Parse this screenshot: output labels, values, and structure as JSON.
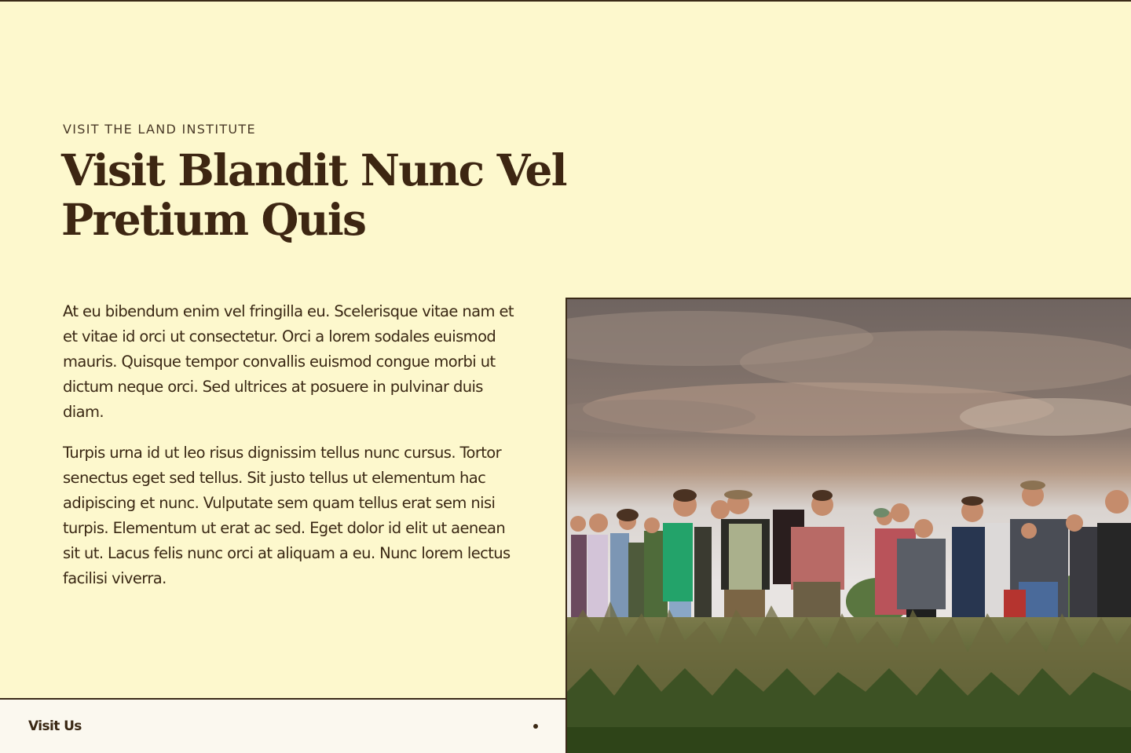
{
  "hero": {
    "eyebrow": "VISIT THE LAND INSTITUTE",
    "title_line1": "Visit Blandit Nunc Vel",
    "title_line2": "Pretium Quis"
  },
  "content": {
    "paragraphs": [
      "At eu bibendum enim vel fringilla eu. Scelerisque vitae nam et et vitae id orci ut consectetur. Orci a lorem sodales euismod mauris. Quisque tempor convallis euismod congue morbi ut dictum neque orci. Sed ultrices at posuere in pulvinar duis diam.",
      "Turpis urna id ut leo risus dignissim tellus nunc cursus. Tortor senectus eget sed tellus. Sit justo tellus ut elementum hac adipiscing et nunc. Vulputate sem quam tellus erat sem nisi turpis. Elementum ut erat ac sed. Eget dolor id elit ut aenean sit ut. Lacus felis nunc orci at aliquam a eu. Nunc lorem lectus facilisi viverra."
    ]
  },
  "cta": {
    "label": "Visit Us",
    "icon": "dot-icon"
  },
  "image": {
    "subject": "group-tour-photo"
  },
  "colors": {
    "background": "#fdf8cd",
    "text": "#3d2612",
    "rule": "#3a2a18",
    "cta_bg": "#fbf8ef"
  }
}
